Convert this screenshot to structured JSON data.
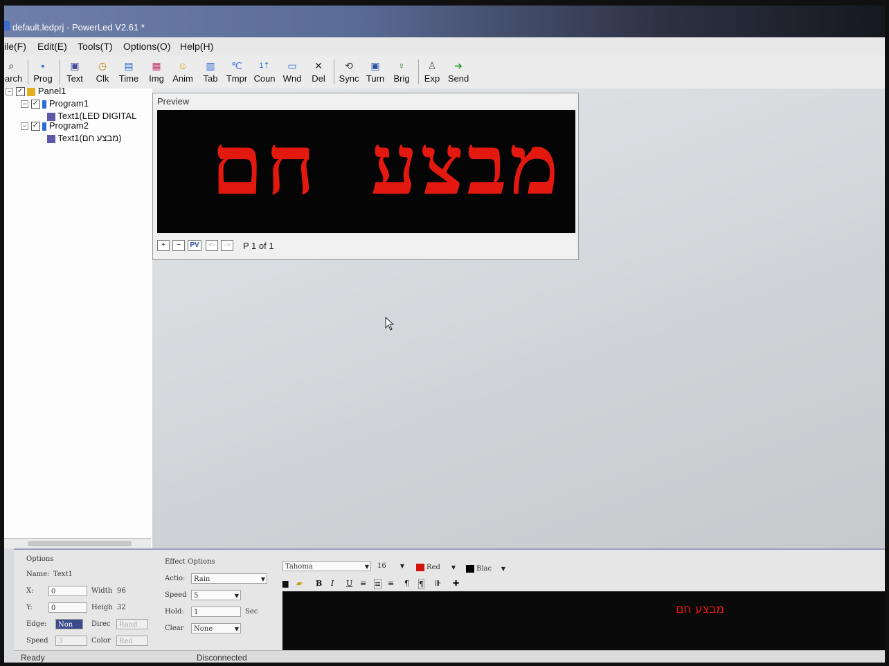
{
  "window": {
    "title": "default.ledprj - PowerLed V2.61 *"
  },
  "menu": [
    "ile(F)",
    "Edit(E)",
    "Tools(T)",
    "Options(O)",
    "Help(H)"
  ],
  "toolbar": [
    {
      "label": "earch",
      "icon": "search-icon",
      "glyph": "⌕"
    },
    {
      "label": "Prog",
      "icon": "program-icon",
      "glyph": "▪"
    },
    {
      "label": "Text",
      "icon": "text-icon",
      "glyph": "▣"
    },
    {
      "label": "Clk",
      "icon": "clock-icon",
      "glyph": "◷"
    },
    {
      "label": "Time",
      "icon": "time-icon",
      "glyph": "▤"
    },
    {
      "label": "Img",
      "icon": "image-icon",
      "glyph": "▦"
    },
    {
      "label": "Anim",
      "icon": "animation-icon",
      "glyph": "☺"
    },
    {
      "label": "Tab",
      "icon": "table-icon",
      "glyph": "▥"
    },
    {
      "label": "Tmpr",
      "icon": "temperature-icon",
      "glyph": "℃"
    },
    {
      "label": "Coun",
      "icon": "counter-icon",
      "glyph": "1⇡"
    },
    {
      "label": "Wnd",
      "icon": "window-icon",
      "glyph": "▭"
    },
    {
      "label": "Del",
      "icon": "delete-icon",
      "glyph": "✕"
    },
    {
      "label": "Sync",
      "icon": "sync-icon",
      "glyph": "⟲"
    },
    {
      "label": "Turn",
      "icon": "turn-icon",
      "glyph": "▣"
    },
    {
      "label": "Brig",
      "icon": "brightness-icon",
      "glyph": "♀"
    },
    {
      "label": "Exp",
      "icon": "export-icon",
      "glyph": "♙"
    },
    {
      "label": "Send",
      "icon": "send-icon",
      "glyph": "➔"
    }
  ],
  "tree": {
    "panel": "Panel1",
    "program1": "Program1",
    "program1_text": "Text1(LED DIGITAL",
    "program2": "Program2",
    "program2_text": "Text1(מבצע חם)"
  },
  "preview": {
    "title": "Preview",
    "led_text": "מבצע חם",
    "page_label": "P 1 of 1",
    "ctrl_plus": "+",
    "ctrl_minus": "−",
    "ctrl_pv": "PV",
    "ctrl_prev": "<-",
    "ctrl_next": "->"
  },
  "options": {
    "title": "Options",
    "name_label": "Name:",
    "name_value": "Text1",
    "x_label": "X:",
    "x_value": "0",
    "y_label": "Y:",
    "y_value": "0",
    "width_label": "Width",
    "width_value": "96",
    "height_label": "Heigh",
    "height_value": "32",
    "edge_label": "Edge:",
    "edge_value": "Non",
    "direction_label": "Direc",
    "direction_value": "Rand",
    "speed_label": "Speed",
    "speed_value": "3",
    "color_label": "Color",
    "color_value": "Red"
  },
  "effects": {
    "title": "Effect Options",
    "action_label": "Actio:",
    "action_value": "Rain",
    "speed_label": "Speed",
    "speed_value": "5",
    "hold_label": "Hold:",
    "hold_value": "1",
    "hold_unit": "Sec",
    "clear_label": "Clear",
    "clear_value": "None"
  },
  "text_editor": {
    "font": "Tahoma",
    "size": "16",
    "fg_color_name": "Red",
    "bg_color_name": "Blac",
    "fg_color": "#d0140c",
    "bg_color": "#000000",
    "preview_text": "מבצע חם"
  },
  "status": {
    "left": "Ready",
    "center": "Disconnected"
  }
}
